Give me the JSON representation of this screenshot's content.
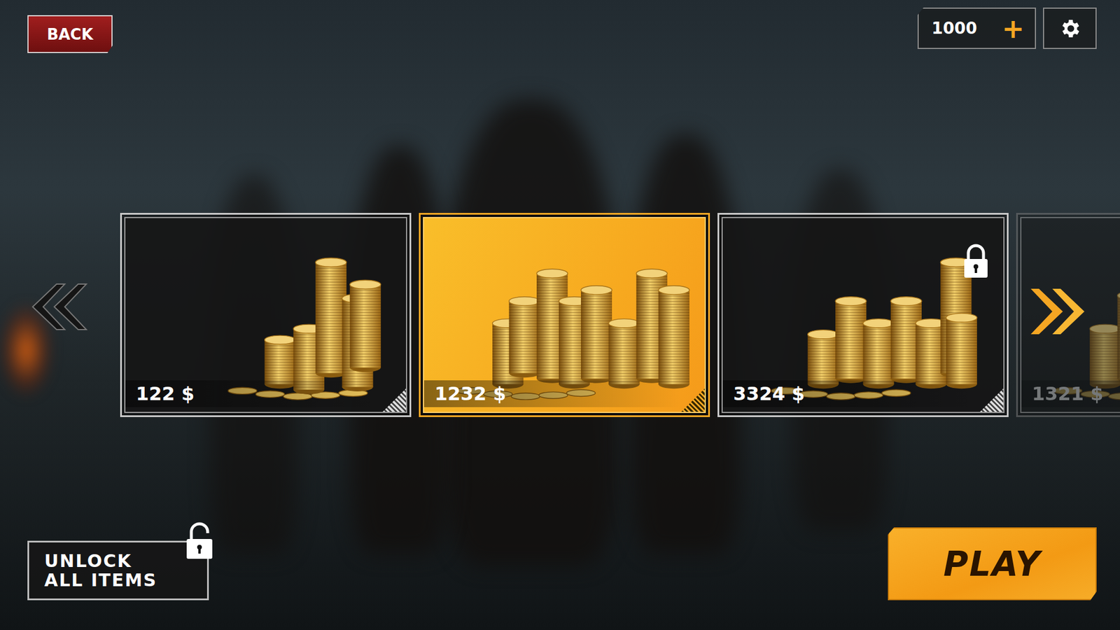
{
  "header": {
    "back": "BACK",
    "coins": "1000",
    "add": "+"
  },
  "items": [
    {
      "price": "122 $",
      "selected": false,
      "locked": false,
      "dimmed": false
    },
    {
      "price": "1232 $",
      "selected": true,
      "locked": false,
      "dimmed": false
    },
    {
      "price": "3324 $",
      "selected": false,
      "locked": true,
      "dimmed": false
    },
    {
      "price": "1321 $",
      "selected": false,
      "locked": false,
      "dimmed": true
    }
  ],
  "unlock": {
    "lines": [
      "UNLOCK",
      "ALL ITEMS"
    ],
    "locked": false
  },
  "play": {
    "label": "PLAY"
  }
}
